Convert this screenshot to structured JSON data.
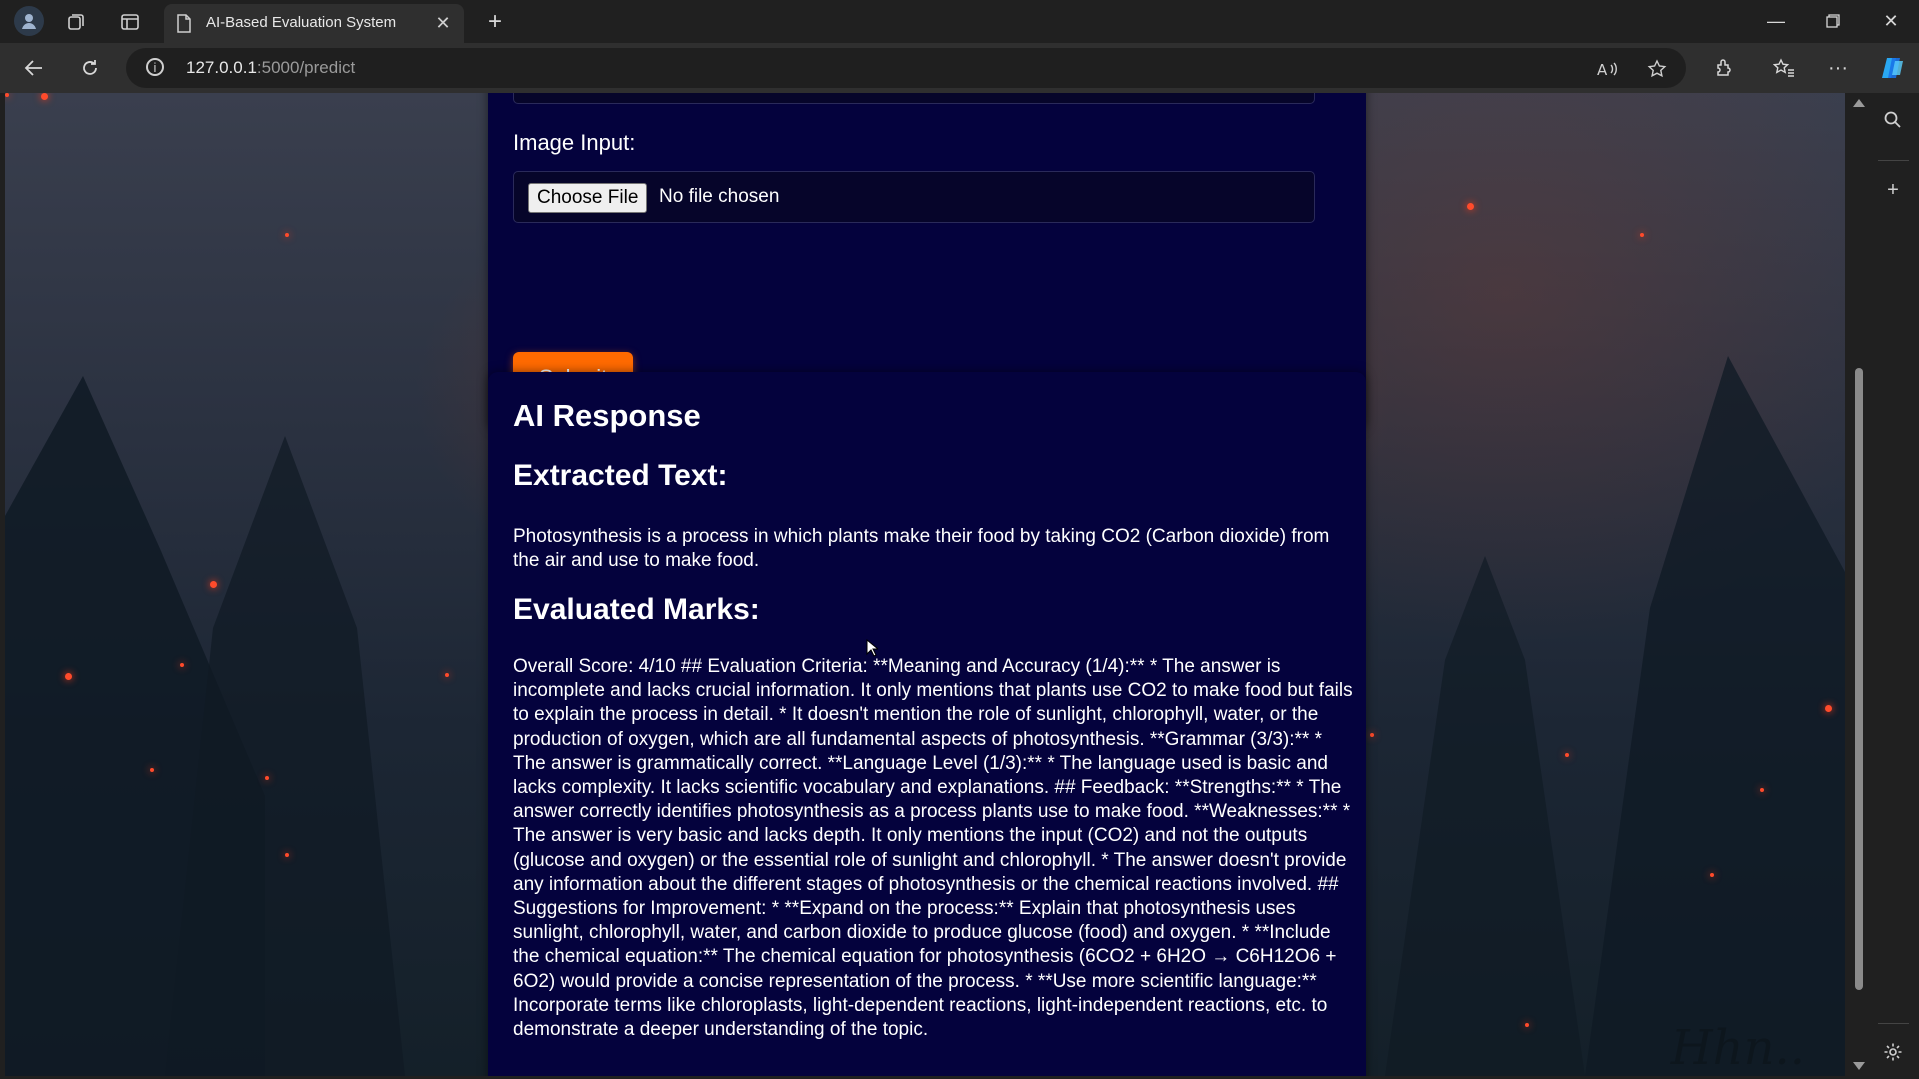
{
  "browser": {
    "tab_title": "AI-Based Evaluation System",
    "url_host": "127.0.0.1",
    "url_rest": ":5000/predict"
  },
  "form": {
    "image_label": "Image Input:",
    "choose_file_label": "Choose File",
    "no_file_text": "No file chosen",
    "submit_label": "Submit"
  },
  "response": {
    "heading": "AI Response",
    "extracted_heading": "Extracted Text:",
    "extracted_text": "Photosynthesis is a process in which plants make their food by taking CO2 (Carbon dioxide) from the air and use to make food.",
    "marks_heading": "Evaluated Marks:",
    "marks_text": "Overall Score: 4/10 ## Evaluation Criteria: **Meaning and Accuracy (1/4):** * The answer is incomplete and lacks crucial information. It only mentions that plants use CO2 to make food but fails to explain the process in detail. * It doesn't mention the role of sunlight, chlorophyll, water, or the production of oxygen, which are all fundamental aspects of photosynthesis. **Grammar (3/3):** * The answer is grammatically correct. **Language Level (1/3):** * The language used is basic and lacks complexity. It lacks scientific vocabulary and explanations. ## Feedback: **Strengths:** * The answer correctly identifies photosynthesis as a process plants use to make food. **Weaknesses:** * The answer is very basic and lacks depth. It only mentions the input (CO2) and not the outputs (glucose and oxygen) or the essential role of sunlight and chlorophyll. * The answer doesn't provide any information about the different stages of photosynthesis or the chemical reactions involved. ## Suggestions for Improvement: * **Expand on the process:** Explain that photosynthesis uses sunlight, chlorophyll, water, and carbon dioxide to produce glucose (food) and oxygen. * **Include the chemical equation:** The chemical equation for photosynthesis (6CO2 + 6H2O → C6H12O6 + 6O2) would provide a concise representation of the process. * **Use more scientific language:** Incorporate terms like chloroplasts, light-dependent reactions, light-independent reactions, etc. to demonstrate a deeper understanding of the topic."
  },
  "colors": {
    "card_bg": "#04023d",
    "submit_bg": "#ff6a00"
  }
}
